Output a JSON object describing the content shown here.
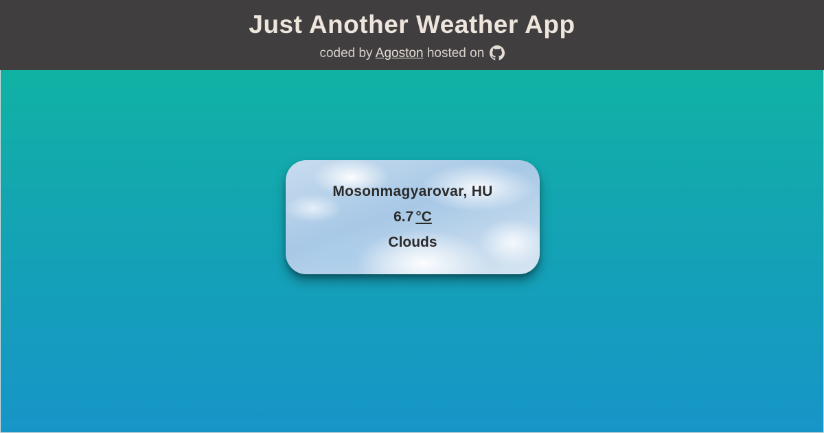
{
  "header": {
    "title": "Just Another Weather App",
    "coded_by": "coded by",
    "author_link": "Agoston",
    "hosted_on": "hosted on",
    "host_icon": "github-icon"
  },
  "weather": {
    "location": "Mosonmagyarovar, HU",
    "temperature": "6.7",
    "unit": "°C",
    "condition": "Clouds"
  },
  "colors": {
    "header_bg": "#403e3f",
    "title_text": "#eee5dc",
    "gradient_top": "#0fb99d",
    "gradient_bottom": "#1795c8",
    "card_text": "#2a2a2a"
  }
}
